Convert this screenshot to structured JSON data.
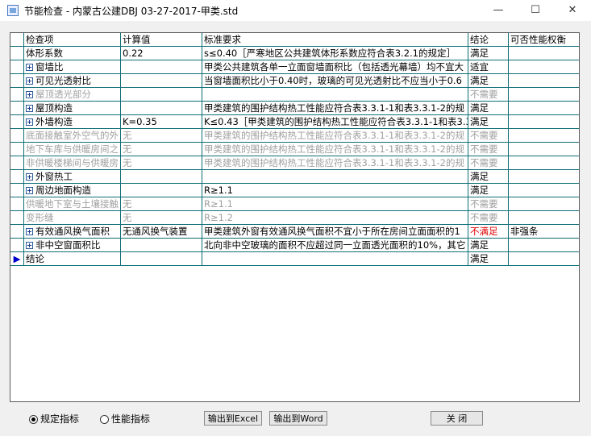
{
  "window": {
    "title": "节能检查 - 内蒙古公建DBJ 03-27-2017-甲类.std",
    "minimize": "—",
    "maximize": "☐",
    "close": "✕"
  },
  "grid": {
    "headers": [
      "检查项",
      "计算值",
      "标准要求",
      "结论",
      "可否性能权衡"
    ],
    "rows": [
      {
        "item": "体形系数",
        "value": "0.22",
        "requirement": "s≤0.40［严寒地区公共建筑体形系数应符合表3.2.1的规定］",
        "conclusion": "满足",
        "tradeoff": ""
      },
      {
        "item": "窗墙比",
        "value": "",
        "requirement": "甲类公共建筑各单一立面窗墙面积比（包括透光幕墙）均不宜大",
        "conclusion": "适宜",
        "tradeoff": ""
      },
      {
        "item": "可见光透射比",
        "value": "",
        "requirement": "当窗墙面积比小于0.40时，玻璃的可见光透射比不应当小于0.6",
        "conclusion": "满足",
        "tradeoff": ""
      },
      {
        "item": "屋顶透光部分",
        "value": "",
        "requirement": "",
        "conclusion": "不需要",
        "tradeoff": ""
      },
      {
        "item": "屋顶构造",
        "value": "",
        "requirement": "甲类建筑的围护结构热工性能应符合表3.3.1-1和表3.3.1-2的规",
        "conclusion": "满足",
        "tradeoff": ""
      },
      {
        "item": "外墙构造",
        "value": "K=0.35",
        "requirement": "K≤0.43［甲类建筑的围护结构热工性能应符合表3.3.1-1和表3.3",
        "conclusion": "满足",
        "tradeoff": ""
      },
      {
        "item": "底面接触室外空气的外",
        "value": "无",
        "requirement": "甲类建筑的围护结构热工性能应符合表3.3.1-1和表3.3.1-2的规",
        "conclusion": "不需要",
        "tradeoff": ""
      },
      {
        "item": "地下车库与供暖房间之",
        "value": "无",
        "requirement": "甲类建筑的围护结构热工性能应符合表3.3.1-1和表3.3.1-2的规",
        "conclusion": "不需要",
        "tradeoff": ""
      },
      {
        "item": "非供暖楼梯间与供暖房",
        "value": "无",
        "requirement": "甲类建筑的围护结构热工性能应符合表3.3.1-1和表3.3.1-2的规",
        "conclusion": "不需要",
        "tradeoff": ""
      },
      {
        "item": "外窗热工",
        "value": "",
        "requirement": "",
        "conclusion": "满足",
        "tradeoff": ""
      },
      {
        "item": "周边地面构造",
        "value": "",
        "requirement": "R≥1.1",
        "conclusion": "满足",
        "tradeoff": ""
      },
      {
        "item": "供暖地下室与土壤接触",
        "value": "无",
        "requirement": "R≥1.1",
        "conclusion": "不需要",
        "tradeoff": ""
      },
      {
        "item": "变形缝",
        "value": "无",
        "requirement": "R≥1.2",
        "conclusion": "不需要",
        "tradeoff": ""
      },
      {
        "item": "有效通风换气面积",
        "value": "无通风换气装置",
        "requirement": "甲类建筑外窗有效通风换气面积不宜小于所在房间立面面积的1",
        "conclusion": "不满足",
        "tradeoff": "非强条"
      },
      {
        "item": "非中空窗面积比",
        "value": "",
        "requirement": "北向非中空玻璃的面积不应超过同一立面透光面积的10%，其它",
        "conclusion": "满足",
        "tradeoff": ""
      },
      {
        "item": "结论",
        "value": "",
        "requirement": "",
        "conclusion": "满足",
        "tradeoff": ""
      }
    ]
  },
  "footer": {
    "radio_standard": "规定指标",
    "radio_performance": "性能指标",
    "export_excel": "输出到Excel",
    "export_word": "输出到Word",
    "close": "关 闭"
  },
  "colors": {
    "grid_line": "#0e6e77",
    "fail_text": "#e00000",
    "disabled_text": "#a0a0a0",
    "row_indicator": "#0000cc"
  }
}
